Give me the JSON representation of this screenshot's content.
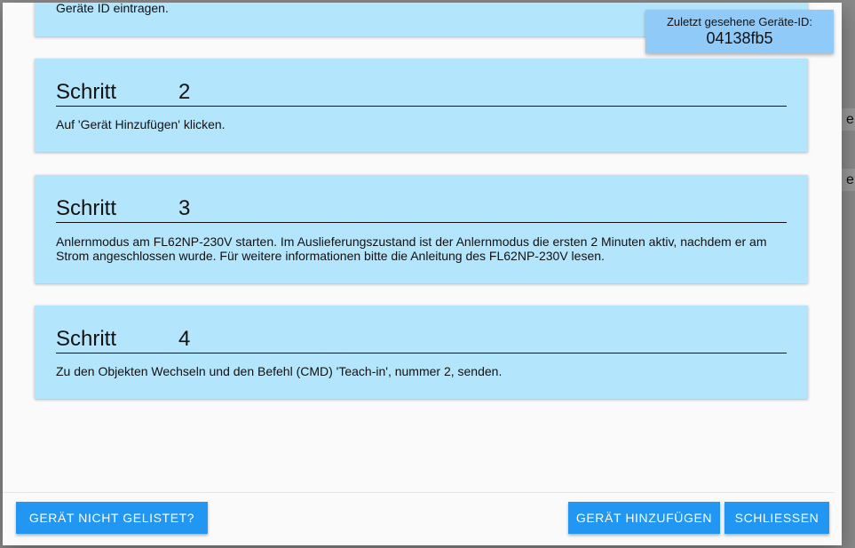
{
  "background": {
    "right_chars": [
      "e",
      "e"
    ]
  },
  "step1": {
    "text_partial": "Geräte ID eintragen."
  },
  "device_id": {
    "label": "Zuletzt gesehene Geräte-ID:",
    "value": "04138fb5"
  },
  "steps": [
    {
      "word": "Schritt",
      "number": "2",
      "text": "Auf 'Gerät Hinzufügen' klicken."
    },
    {
      "word": "Schritt",
      "number": "3",
      "text": "Anlernmodus am FL62NP-230V starten. Im Auslieferungszustand ist der Anlernmodus die ersten 2 Minuten aktiv, nachdem er am Strom angeschlossen wurde. Für weitere informationen bitte die Anleitung des FL62NP-230V lesen."
    },
    {
      "word": "Schritt",
      "number": "4",
      "text": "Zu den Objekten Wechseln und den Befehl (CMD) 'Teach-in', nummer 2, senden."
    }
  ],
  "buttons": {
    "not_listed": "GERÄT NICHT GELISTET?",
    "add": "GERÄT HINZUFÜGEN",
    "close": "SCHLIESSEN"
  },
  "colors": {
    "card": "#b3e5fc",
    "device_box": "#90caf9",
    "button": "#2196f3"
  }
}
